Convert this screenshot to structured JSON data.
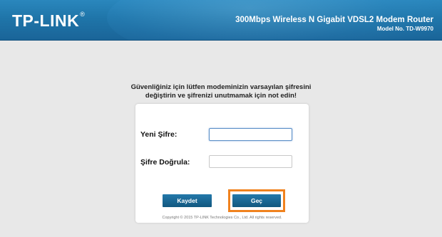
{
  "header": {
    "logo_text": "TP-LINK",
    "logo_mark": "®",
    "product_name": "300Mbps Wireless N Gigabit VDSL2 Modem Router",
    "model_no": "Model No. TD-W9970"
  },
  "message": {
    "line1": "Güvenliğiniz için lütfen modeminizin varsayılan şifresini",
    "line2": "değiştirin ve şifrenizi unutmamak için not edin!"
  },
  "form": {
    "new_password_label": "Yeni Şifre:",
    "new_password_value": "",
    "confirm_password_label": "Şifre Doğrula:",
    "confirm_password_value": "",
    "save_label": "Kaydet",
    "skip_label": "Geç",
    "copyright": "Copyright © 2015 TP-LINK Technologies Co., Ltd. All rights reserved."
  },
  "colors": {
    "header_blue": "#1f75a9",
    "button_blue": "#1a6590",
    "highlight_orange": "#f0821e"
  }
}
